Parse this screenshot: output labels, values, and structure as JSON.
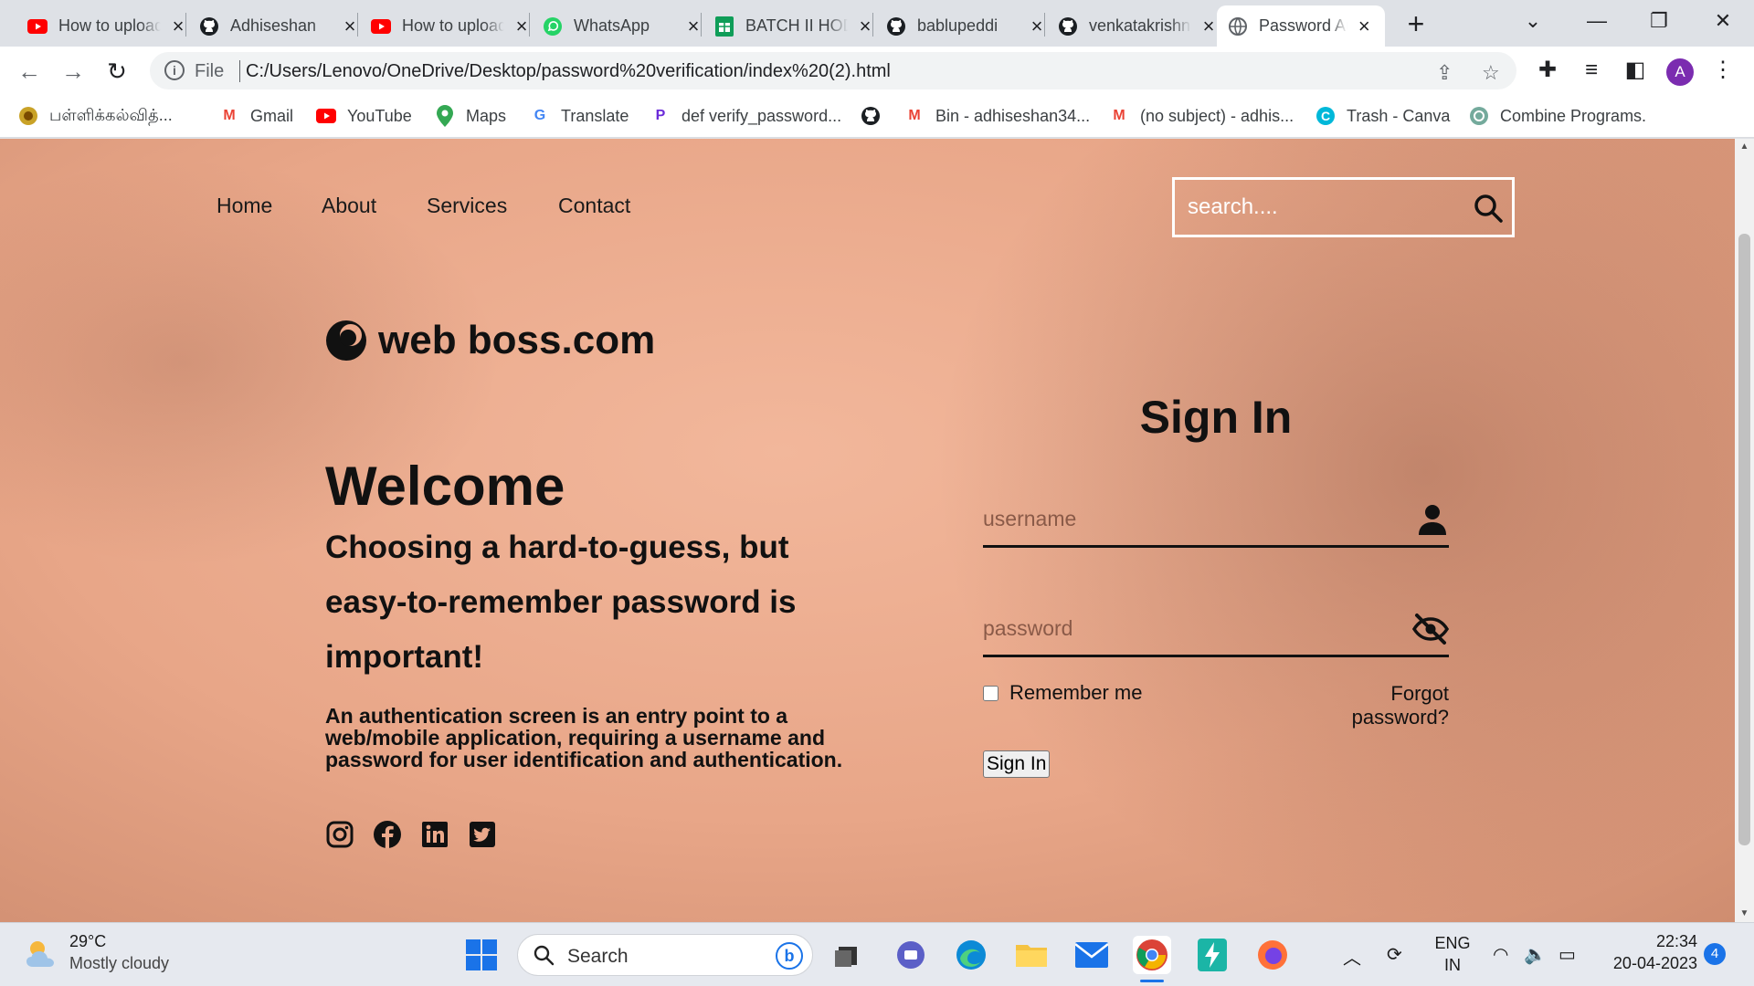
{
  "browser": {
    "tabs": [
      {
        "title": "How to upload",
        "icon": "youtube-icon"
      },
      {
        "title": "Adhiseshan",
        "icon": "github-icon"
      },
      {
        "title": "How to upload",
        "icon": "youtube-icon"
      },
      {
        "title": "WhatsApp",
        "icon": "whatsapp-icon"
      },
      {
        "title": "BATCH II HOD",
        "icon": "sheets-icon"
      },
      {
        "title": "bablupeddi",
        "icon": "github-icon"
      },
      {
        "title": "venkatakrishna",
        "icon": "github-icon"
      },
      {
        "title": "Password Authentication",
        "icon": "globe-icon"
      }
    ],
    "address": {
      "scheme": "File",
      "url": "C:/Users/Lenovo/OneDrive/Desktop/password%20verification/index%20(2).html"
    },
    "bookmarks": [
      {
        "label": "பள்ளிக்கல்வித்...",
        "icon": "emblem-icon"
      },
      {
        "label": "Gmail",
        "icon": "gmail-icon"
      },
      {
        "label": "YouTube",
        "icon": "youtube-icon"
      },
      {
        "label": "Maps",
        "icon": "maps-icon"
      },
      {
        "label": "Translate",
        "icon": "translate-icon"
      },
      {
        "label": "def verify_password...",
        "icon": "perplexity-icon"
      },
      {
        "label": "",
        "icon": "github-icon"
      },
      {
        "label": "Bin - adhiseshan34...",
        "icon": "gmail-icon"
      },
      {
        "label": "(no subject) - adhis...",
        "icon": "gmail-icon"
      },
      {
        "label": "Trash - Canva",
        "icon": "canva-icon"
      },
      {
        "label": "Combine Programs.",
        "icon": "chatgpt-icon"
      }
    ],
    "profile_initial": "A"
  },
  "site": {
    "nav": [
      "Home",
      "About",
      "Services",
      "Contact"
    ],
    "search_placeholder": "search....",
    "brand": "web boss.com",
    "welcome": "Welcome",
    "tagline": "Choosing a hard-to-guess, but easy-to-remember password is important!",
    "description": "An authentication screen is an entry point to a web/mobile application, requiring a username and password for user identification and authentication.",
    "social": [
      "instagram-icon",
      "facebook-icon",
      "linkedin-icon",
      "twitter-icon"
    ],
    "signin": {
      "title": "Sign In",
      "username_placeholder": "username",
      "password_placeholder": "password",
      "remember": "Remember me",
      "forgot": "Forgot password?",
      "button": "Sign In"
    }
  },
  "taskbar": {
    "weather_temp": "29°C",
    "weather_desc": "Mostly cloudy",
    "search_label": "Search",
    "lang_top": "ENG",
    "lang_bottom": "IN",
    "time": "22:34",
    "date": "20-04-2023",
    "notifications": "4"
  },
  "colors": {
    "page_bg": "#eba98b",
    "accent": "#1a73e8",
    "text_dark": "#111111"
  }
}
